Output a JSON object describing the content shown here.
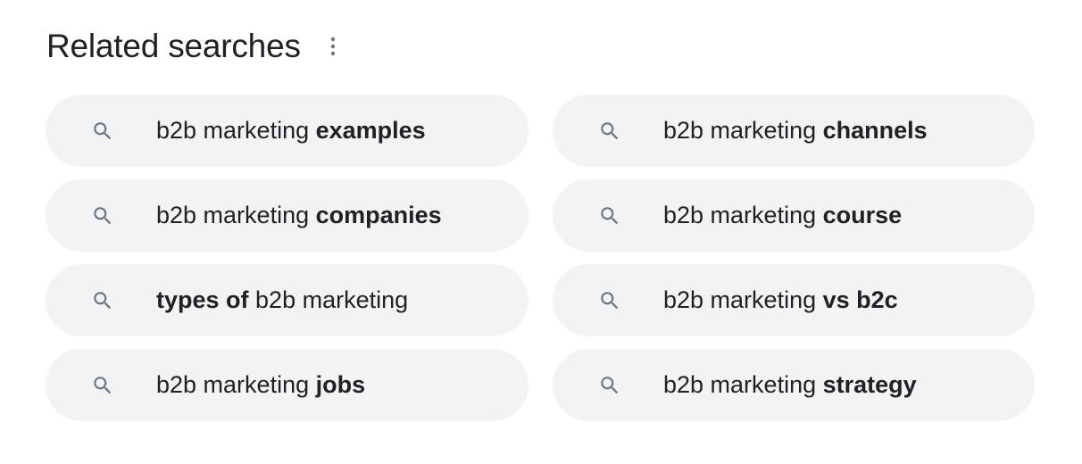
{
  "header": {
    "title": "Related searches",
    "more_icon": "more-vert-icon"
  },
  "colors": {
    "chip_background": "#f1f3f4",
    "text": "#202124",
    "icon": "#70757a"
  },
  "chips": [
    {
      "pre": "b2b marketing ",
      "bold": "examples",
      "post": "",
      "icon": "search-icon"
    },
    {
      "pre": "b2b marketing ",
      "bold": "channels",
      "post": "",
      "icon": "search-icon"
    },
    {
      "pre": "b2b marketing ",
      "bold": "companies",
      "post": "",
      "icon": "search-icon"
    },
    {
      "pre": "b2b marketing ",
      "bold": "course",
      "post": "",
      "icon": "search-icon"
    },
    {
      "pre": "",
      "bold": "types of",
      "post": " b2b marketing",
      "icon": "search-icon"
    },
    {
      "pre": "b2b marketing ",
      "bold": "vs b2c",
      "post": "",
      "icon": "search-icon"
    },
    {
      "pre": "b2b marketing ",
      "bold": "jobs",
      "post": "",
      "icon": "search-icon"
    },
    {
      "pre": "b2b marketing ",
      "bold": "strategy",
      "post": "",
      "icon": "search-icon"
    }
  ]
}
